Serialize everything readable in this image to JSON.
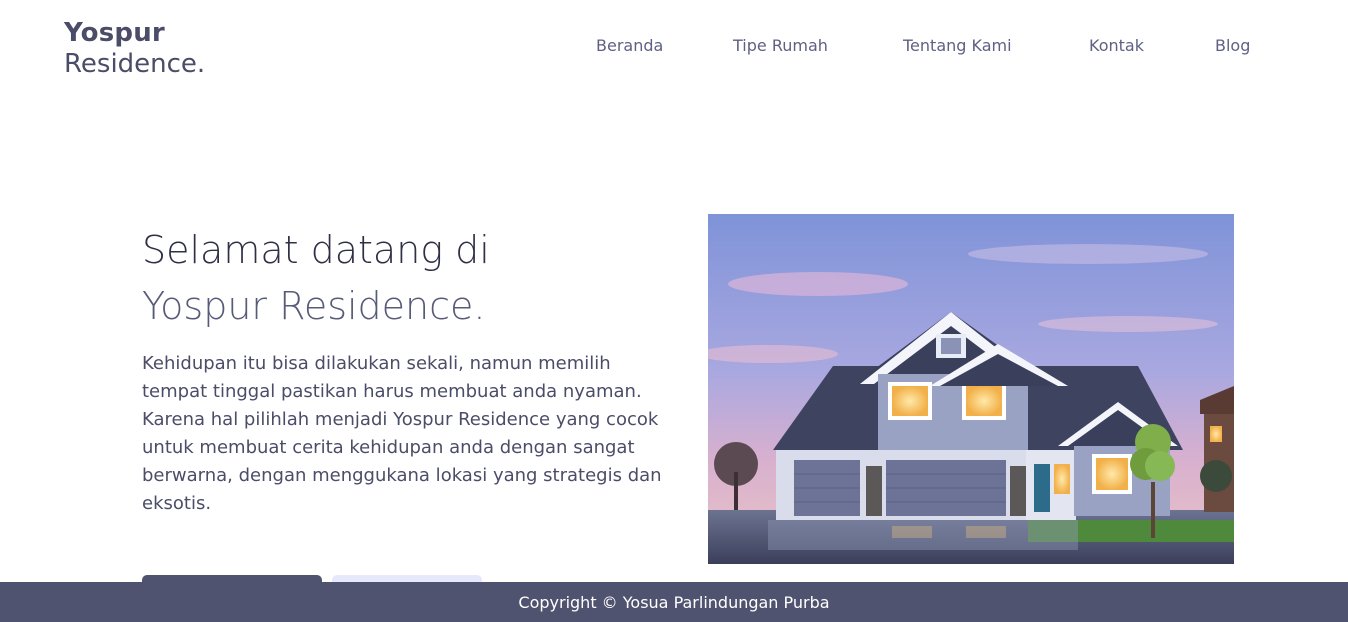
{
  "brand": {
    "name_bold": "Yospur",
    "name_light": "Residence."
  },
  "nav": {
    "items": [
      {
        "label": "Beranda"
      },
      {
        "label": "Tipe Rumah"
      },
      {
        "label": "Tentang Kami"
      },
      {
        "label": "Kontak"
      },
      {
        "label": "Blog"
      }
    ]
  },
  "hero": {
    "title_line1": "Selamat datang di",
    "title_line2": "Yospur Residence.",
    "description": "Kehidupan itu bisa dilakukan sekali, namun memilih tempat tinggal pastikan harus membuat anda nyaman. Karena hal pilihlah menjadi Yospur Residence yang cocok untuk membuat cerita kehidupan anda dengan sangat berwarna, dengan menggukana lokasi yang strategis dan eksotis."
  },
  "colors": {
    "accent": "#50536f",
    "accent_light": "#e6e8fb",
    "text": "#4b4d68"
  },
  "footer": {
    "copyright": "Copyright © Yosua Parlindungan Purba"
  }
}
